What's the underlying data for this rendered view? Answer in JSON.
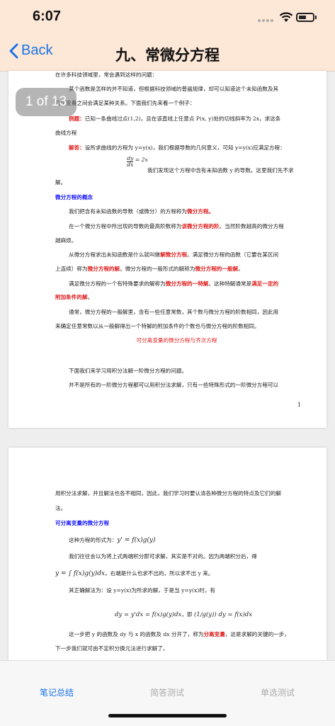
{
  "status": {
    "time": "6:07"
  },
  "nav": {
    "back_label": "Back",
    "title": "九、常微分方程"
  },
  "badge": {
    "text": "1 of 13"
  },
  "page1": {
    "l1": "在许多科技领域里，常会遇到这样的问题：",
    "l2": "某个函数是怎样的并不知道，但根据科技领域的普遍规律，却可以知道这个未知函数及其",
    "l3": "几个变量之间会满足某种关系。下面我们先来看一个例子：",
    "example_label": "例题：",
    "example_text": "已知一条曲线过点(1,2)，且在该直线上任意点 P(x, y)处的切线斜率为 2x，求这条",
    "example_text2": "曲线方程",
    "answer_label": "解答：",
    "answer_text": "设所求曲线的方程为 y=y(x)，我们根据导数的几何意义，可知 y=y(x)应满足方程：",
    "formula": "dy/dx = 2x",
    "formula_after": "我们发现这个方程中含有未知函数 y 的导数。这里我们先不求",
    "solve": "解。",
    "h1": "微分方程的概念",
    "p1a": "我们把含有未知函数的导数（或微分）的方程称为",
    "p1b": "微分方程。",
    "p2a": "在一个微分方程中所出现的导数的最高阶数称为",
    "p2b": "该微分方程的阶",
    "p2c": "。当然阶数越高的微分方程",
    "p2d": "越麻烦。",
    "p3a": "从微分方程求出未知函数是什么就叫做",
    "p3b": "解微分方程",
    "p3c": "。满足微分方程的函数（它要在某区间",
    "p3d": "上连续）称为",
    "p3e": "微分方程的解",
    "p3f": "。微分方程的一般形式的解称为",
    "p3g": "微分方程的一般解",
    "p3h": "。",
    "p4a": "满足微分方程的一个有特殊要求的解称为",
    "p4b": "微分方程的一特解",
    "p4c": "。这种特解通常是",
    "p4d": "满足一定的",
    "p4e": "附加条件的解",
    "p4f": "。",
    "p5": "通常，微分方程的一般解里，含有一些任意常数，其个数与微分方程的阶数相同，因此用",
    "p5b": "来确定任意常数以从一般解得出一个特解的附加条件的个数也与微分方程的阶数相同。",
    "link": "可分离变量的微分方程与齐次方程",
    "p6": "下面我们来学习用积分法解一阶微分方程的问题。",
    "p7": "并不是所有的一阶微分方程都可以用积分法求解，只有一些特殊形式的一阶微分方程可以",
    "page_number": "1"
  },
  "page2": {
    "l1": "用积分法求解，并且解法也各不相同，因此，我们学习时要认清各种微分方程的特点及它们的解",
    "l2": "法。",
    "h1": "可分离变量的微分方程",
    "l3": "这种方程的形式为：",
    "f1": "y' = f(x)g(y)",
    "l4": "我们往往会以为将上式两端积分即可求解，其实是不对的。因为两端积分后，得",
    "f2": "y = ∫ f(x)g(y)dx",
    "l5": "，右端是什么也求不出的，所以求不出 y 来。",
    "l6": "其正确解法为：设 y=y(x)为所求的解，于是当 y=y(x)时，有",
    "f3": "dy = y'dx = f(x)g(y)dx",
    "f3mid": "，即",
    "f4": "(1/g(y)) dy = f(x)dx",
    "l7a": "这一步把 y 的函数及 dy 与 x 的函数及 dx 分开了，称为",
    "l7b": "分离变量",
    "l7c": "，这是求解的关键的一步，",
    "l8": "下一步我们就可由不定积分换元法进行求解了。"
  },
  "tabs": {
    "notes": "笔记总结",
    "short": "简答测试",
    "single": "单选测试"
  },
  "colors": {
    "accent": "#1a73e8",
    "highlight_red": "#e02020",
    "heading_blue": "#1a1aff",
    "header_bg": "#fde7d6"
  }
}
